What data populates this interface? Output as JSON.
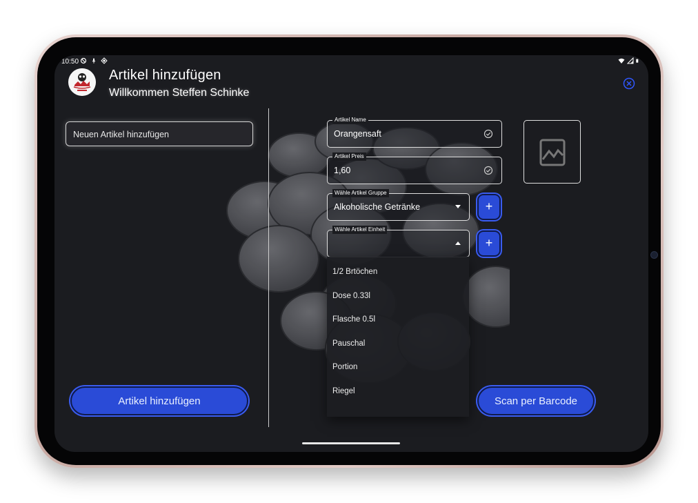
{
  "status_bar": {
    "time": "10:50"
  },
  "header": {
    "title": "Artikel hinzufügen",
    "subtitle": "Willkommen Steffen Schinke"
  },
  "left_panel": {
    "new_item_input_value": "Neuen Artikel hinzufügen",
    "add_button_label": "Artikel hinzufügen"
  },
  "form": {
    "name": {
      "label": "Artikel Name",
      "value": "Orangensaft"
    },
    "price": {
      "label": "Artikel Preis",
      "value": "1,60"
    },
    "group": {
      "label": "Wähle Artikel Gruppe",
      "value": "Alkoholische Getränke"
    },
    "unit": {
      "label": "Wähle Artikel Einheit",
      "value": ""
    },
    "scan_button_label": "Scan per Barcode"
  },
  "unit_options": [
    "1/2 Brtöchen",
    "Dose 0.33l",
    "Flasche 0.5l",
    "Pauschal",
    "Portion",
    "Riegel"
  ],
  "colors": {
    "accent": "#2a4bd7",
    "background": "#1b1c20"
  }
}
